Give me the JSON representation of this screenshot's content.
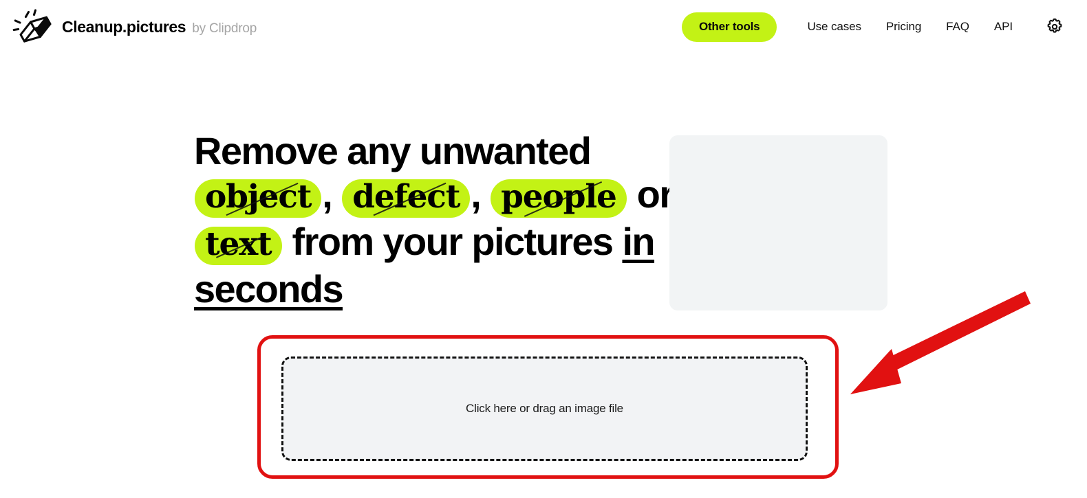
{
  "header": {
    "brand": {
      "logo_icon": "eraser-icon",
      "name": "Cleanup.pictures",
      "byline": "by Clipdrop"
    },
    "nav": {
      "pill": {
        "label": "Other tools"
      },
      "links": [
        {
          "label": "Use cases",
          "name": "use-cases"
        },
        {
          "label": "Pricing",
          "name": "pricing"
        },
        {
          "label": "FAQ",
          "name": "faq"
        },
        {
          "label": "API",
          "name": "api"
        }
      ],
      "settings_icon": "gear-icon"
    }
  },
  "hero": {
    "headline": {
      "line1": "Remove any unwanted",
      "highlight_1": "object",
      "comma_1": ",",
      "highlight_2": "defect",
      "comma_2": ",",
      "highlight_3": "people",
      "or": "or",
      "highlight_4": "text",
      "line3_rest": "from your pictures",
      "underlined_1": "in",
      "underlined_2": "seconds"
    }
  },
  "preview": {
    "name": "image-preview-placeholder",
    "state": "empty"
  },
  "uploader": {
    "label": "Click here or drag an image file"
  },
  "annotations": {
    "highlight_box": {
      "color": "#e11111",
      "shape": "rounded-rectangle"
    },
    "arrow": {
      "color": "#e11111",
      "direction": "down-left",
      "points_to": "image-upload-dropzone"
    }
  },
  "colors": {
    "accent_lime": "#c3f215",
    "annotation_red": "#e11111",
    "panel_gray": "#f2f4f5",
    "text_black": "#000000",
    "muted_gray": "#a5a5a5"
  }
}
